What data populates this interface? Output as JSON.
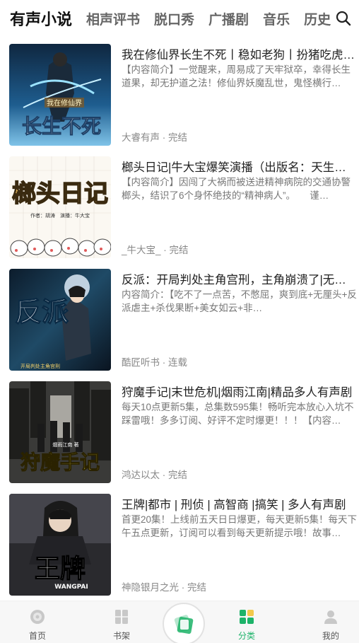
{
  "tabs": [
    {
      "label": "有声小说",
      "active": true
    },
    {
      "label": "相声评书",
      "active": false
    },
    {
      "label": "脱口秀",
      "active": false
    },
    {
      "label": "广播剧",
      "active": false
    },
    {
      "label": "音乐",
      "active": false
    },
    {
      "label": "历史",
      "active": false
    }
  ],
  "search_icon": "search-icon",
  "items": [
    {
      "title": "我在修仙界长生不死丨稳如老狗丨扮猪吃虎…",
      "desc": "【内容简介】一觉醒来，周易成了天牢狱卒，幸得长生道果，却无护道之法！修仙界妖魔乱世，鬼怪横行…",
      "meta": "大睿有声 · 完结",
      "cover_text": "长生不死",
      "cover_subtext": "我在修仙界"
    },
    {
      "title": "榔头日记|牛大宝爆笑演播（出版名：天生废…",
      "desc": "【内容简介】因闯了大祸而被送进精神病院的交通协警榔头，结识了6个身怀绝技的“精神病人”。　　谨…",
      "meta": "_牛大宝_ · 完结",
      "cover_text": "榔头日记",
      "cover_subtext": "作者：胡涛　演播：牛大宝"
    },
    {
      "title": "反派：开局判处主角宫刑，主角崩溃了|无厘…",
      "desc": "内容简介：【吃不了一点苦，不憋屈，爽到底+无厘头+反派虐主+杀伐果断+美女如云+非…",
      "meta": "酷匠听书 · 连载",
      "cover_text": "反派",
      "cover_subtext": "开局判处主角宫刑"
    },
    {
      "title": "狩魔手记|末世危机|烟雨江南|精品多人有声剧",
      "desc": "每天10点更新5集，总集数595集！畅听完本放心入坑不踩雷哦！多多订阅、好评不定时爆更！！！【内容…",
      "meta": "鸿达以太 · 完结",
      "cover_text": "狩魔手记",
      "cover_subtext": "烟雨江南 著"
    },
    {
      "title": "王牌|都市 | 刑侦 | 高智商 |搞笑 | 多人有声剧",
      "desc": "首更20集！上线前五天日日爆更，每天更新5集！每天下午五点更新，订阅可以看到每天更新提示哦！故事…",
      "meta": "神隐银月之光 · 完结",
      "cover_text": "王牌",
      "cover_subtext": "WANGPAI"
    }
  ],
  "nav": [
    {
      "label": "首页",
      "icon": "disc-icon",
      "active": false
    },
    {
      "label": "书架",
      "icon": "bookshelf-icon",
      "active": false
    },
    {
      "label": "",
      "icon": "play-disc-icon",
      "active": false
    },
    {
      "label": "分类",
      "icon": "category-icon",
      "active": true
    },
    {
      "label": "我的",
      "icon": "profile-icon",
      "active": false
    }
  ],
  "colors": {
    "accent": "#1db369",
    "accent_yellow": "#f2c94c"
  }
}
